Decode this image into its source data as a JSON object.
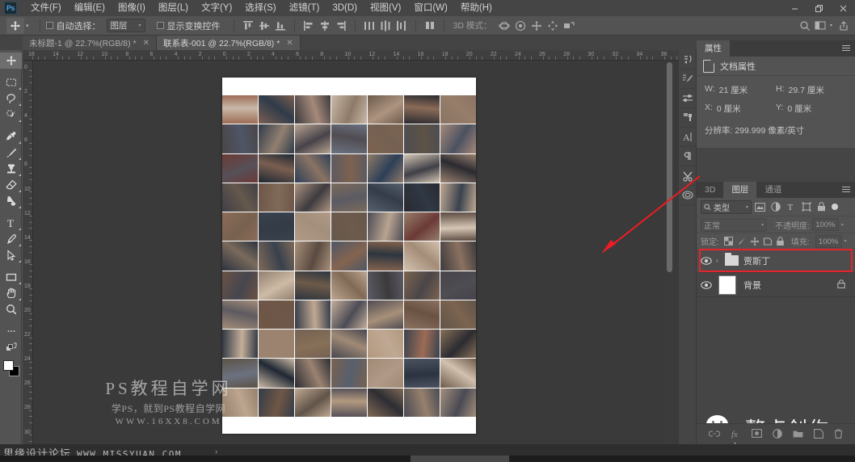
{
  "app": {
    "name": "Adobe Photoshop",
    "logo_text": "Ps"
  },
  "menubar": {
    "items": [
      {
        "label": "文件(F)"
      },
      {
        "label": "编辑(E)"
      },
      {
        "label": "图像(I)"
      },
      {
        "label": "图层(L)"
      },
      {
        "label": "文字(Y)"
      },
      {
        "label": "选择(S)"
      },
      {
        "label": "滤镜(T)"
      },
      {
        "label": "3D(D)"
      },
      {
        "label": "视图(V)"
      },
      {
        "label": "窗口(W)"
      },
      {
        "label": "帮助(H)"
      }
    ],
    "window_controls": [
      {
        "name": "minimize",
        "glyph": "–"
      },
      {
        "name": "maximize",
        "glyph": "❐"
      },
      {
        "name": "close",
        "glyph": "✕"
      }
    ]
  },
  "optionsbar": {
    "tool_icon": "move-tool-icon",
    "auto_select_label": "自动选择：",
    "auto_select_checked": false,
    "auto_select_value": "图层",
    "show_transform_label": "显示变换控件",
    "show_transform_checked": false,
    "align_group_1": [
      "align-top-edges",
      "align-vertical-centers",
      "align-bottom-edges"
    ],
    "align_group_2": [
      "align-left-edges",
      "align-horizontal-centers",
      "align-right-edges"
    ],
    "distribute_group_1": [
      "distribute-top",
      "distribute-vertical-center",
      "distribute-bottom"
    ],
    "distribute_group_2": [
      "distribute-left",
      "distribute-horizontal-center",
      "distribute-right"
    ],
    "more_align": "align-more-options",
    "mode_3d_label": "3D 模式：",
    "mode_3d_tools": [
      "orbit-3d",
      "roll-3d",
      "pan-3d",
      "slide-3d",
      "scale-3d"
    ],
    "search_icon": "search-icon",
    "workspace_icon": "workspace-switcher-icon",
    "share_icon": "share-icon"
  },
  "tabs": [
    {
      "label": "未标题-1 @ 22.7%(RGB/8) *",
      "active": false,
      "close": "✕"
    },
    {
      "label": "联系表-001 @ 22.7%(RGB/8) *",
      "active": true,
      "close": "✕"
    }
  ],
  "toolbar": {
    "tools": [
      {
        "name": "move-tool",
        "selected": true,
        "submenu": false
      },
      {
        "name": "rectangular-marquee-tool",
        "selected": false,
        "submenu": true
      },
      {
        "name": "lasso-tool",
        "selected": false,
        "submenu": true
      },
      {
        "name": "quick-selection-tool",
        "selected": false,
        "submenu": true
      },
      {
        "name": "eyedropper-tool",
        "selected": false,
        "submenu": true
      },
      {
        "name": "brush-tool",
        "selected": false,
        "submenu": true
      },
      {
        "name": "clone-stamp-tool",
        "selected": false,
        "submenu": true
      },
      {
        "name": "eraser-tool",
        "selected": false,
        "submenu": true
      },
      {
        "name": "gradient-tool",
        "selected": false,
        "submenu": true
      },
      {
        "name": "horizontal-type-tool",
        "selected": false,
        "submenu": true
      },
      {
        "name": "pen-tool",
        "selected": false,
        "submenu": true
      },
      {
        "name": "path-selection-tool",
        "selected": false,
        "submenu": true
      },
      {
        "name": "rectangle-tool",
        "selected": false,
        "submenu": true
      },
      {
        "name": "hand-tool",
        "selected": false,
        "submenu": true
      },
      {
        "name": "zoom-tool",
        "selected": false,
        "submenu": false
      },
      {
        "name": "edit-toolbar-ellipsis",
        "selected": false,
        "submenu": false
      },
      {
        "name": "default-colors-swap",
        "selected": false,
        "submenu": false
      }
    ],
    "foreground_color": "#ffffff",
    "background_color": "#000000"
  },
  "rulers": {
    "unit": "厘米",
    "horizontal_ticks": [
      "16",
      "14",
      "12",
      "10",
      "8",
      "6",
      "4",
      "2",
      "0",
      "2",
      "4",
      "6",
      "8",
      "10",
      "12",
      "14",
      "16",
      "18",
      "20",
      "22",
      "24",
      "26",
      "28",
      "30",
      "32",
      "34",
      "36"
    ],
    "vertical_ticks": [
      "0",
      "2",
      "4",
      "6",
      "8",
      "10",
      "12",
      "14",
      "16",
      "18",
      "20",
      "22",
      "24",
      "26",
      "28",
      "30"
    ]
  },
  "canvas": {
    "zoom": "22.7%",
    "watermark_line1": "PS教程自学网",
    "watermark_line2": "学PS，就到PS教程自学网",
    "watermark_line3": "WWW.16XX8.COM",
    "contact_sheet_colors": [
      "#9c6c55",
      "#7b5f50",
      "#3c3a3c",
      "#c9b9a8",
      "#6d5b4c",
      "#2b2b30",
      "#8a7363",
      "#4a4548",
      "#2f3b4a",
      "#b8a390",
      "#6b7280",
      "#7d6250",
      "#4d4d52",
      "#a5897a",
      "#6b3a36",
      "#1e2733",
      "#2d3f57",
      "#5d5a60",
      "#8e7a68",
      "#d5c6b5",
      "#9a8270",
      "#3f3f47",
      "#6e5648",
      "#ad9480",
      "#7a6a5c",
      "#57606e",
      "#2a2a30",
      "#c0a892",
      "#8b6b58",
      "#39414d",
      "#b09a87",
      "#66584c",
      "#4c4c55",
      "#977e6b",
      "#5a4a40",
      "#2c3340",
      "#7f6a58",
      "#a89079",
      "#4e5666",
      "#84644f",
      "#d2c1ae",
      "#3d3a3e",
      "#6a5243",
      "#928070",
      "#2e353f",
      "#bda58f",
      "#5b5b63",
      "#7c6450",
      "#47434a",
      "#a38c78",
      "#6f5746",
      "#343c49",
      "#c4ae99",
      "#504c52",
      "#8a7160",
      "#615448",
      "#2f3844",
      "#9b8370",
      "#746152",
      "#46464f",
      "#b2997f",
      "#3a424e",
      "#877058",
      "#5d5246",
      "#cdbba6",
      "#2d2d33",
      "#78614f",
      "#a08a76",
      "#4b5260",
      "#6d5a49",
      "#95806c",
      "#333b47",
      "#bfa893",
      "#565058",
      "#806a56",
      "#4a4a53",
      "#a38f7c"
    ]
  },
  "icondock": {
    "icons": [
      "history-icon",
      "brushes-icon",
      "adjustments-icon",
      "clone-source-icon",
      "character-icon",
      "paragraph-icon",
      "tool-presets-icon",
      "styles-icon"
    ]
  },
  "properties_panel": {
    "tab_label": "属性",
    "menu_icon": "panel-menu-icon",
    "header_label": "文档属性",
    "header_icon": "document-icon",
    "fields": [
      {
        "key": "W:",
        "value": "21 厘米"
      },
      {
        "key": "H:",
        "value": "29.7 厘米"
      },
      {
        "key": "X:",
        "value": "0 厘米"
      },
      {
        "key": "Y:",
        "value": "0 厘米"
      }
    ],
    "resolution_label": "分辨率:",
    "resolution_value": "299.999 像素/英寸"
  },
  "layers_panel": {
    "tabs": [
      {
        "label": "3D",
        "active": false
      },
      {
        "label": "图层",
        "active": true
      },
      {
        "label": "通道",
        "active": false
      }
    ],
    "menu_icon": "panel-menu-icon",
    "filter": {
      "search_icon": "search-icon",
      "type_label": "类型",
      "caret": "⌄",
      "kind_icons": [
        "pixel-filter-icon",
        "adjustment-filter-icon",
        "type-filter-icon",
        "shape-filter-icon",
        "smart-object-filter-icon"
      ],
      "toggle_icon": "filter-toggle-icon"
    },
    "blend_mode": "正常",
    "opacity_label": "不透明度:",
    "opacity_value": "100%",
    "lock_label": "锁定:",
    "lock_icons": [
      "lock-transparent-pixels-icon",
      "lock-image-pixels-icon",
      "lock-position-icon",
      "lock-artboard-nesting-icon",
      "lock-all-icon"
    ],
    "fill_label": "填充:",
    "fill_value": "100%",
    "layers": [
      {
        "name": "贾斯丁",
        "type": "group",
        "visible": true,
        "expanded": false,
        "selected": true,
        "highlighted": true,
        "locked": false,
        "expand_chevron": "›"
      },
      {
        "name": "背景",
        "type": "layer",
        "visible": true,
        "selected": false,
        "highlighted": false,
        "locked": true,
        "lock_icon": "lock-icon"
      }
    ],
    "bottom_buttons": [
      "link-layers-icon",
      "add-layer-style-icon",
      "add-layer-mask-icon",
      "new-adjustment-layer-icon",
      "new-group-icon",
      "new-layer-icon",
      "delete-layer-icon"
    ]
  },
  "wechat_watermark": {
    "logo": "wechat-icon",
    "text": "整点创作"
  },
  "annotation": {
    "arrow_color": "#ee1c24",
    "highlight_color": "#e8232a",
    "arrow_name": "red-pointer-arrow"
  },
  "statusbar": {
    "watermark_cn": "思缘设计论坛",
    "watermark_url": "WWW.MISSYUAN.COM",
    "chevron": "›"
  }
}
